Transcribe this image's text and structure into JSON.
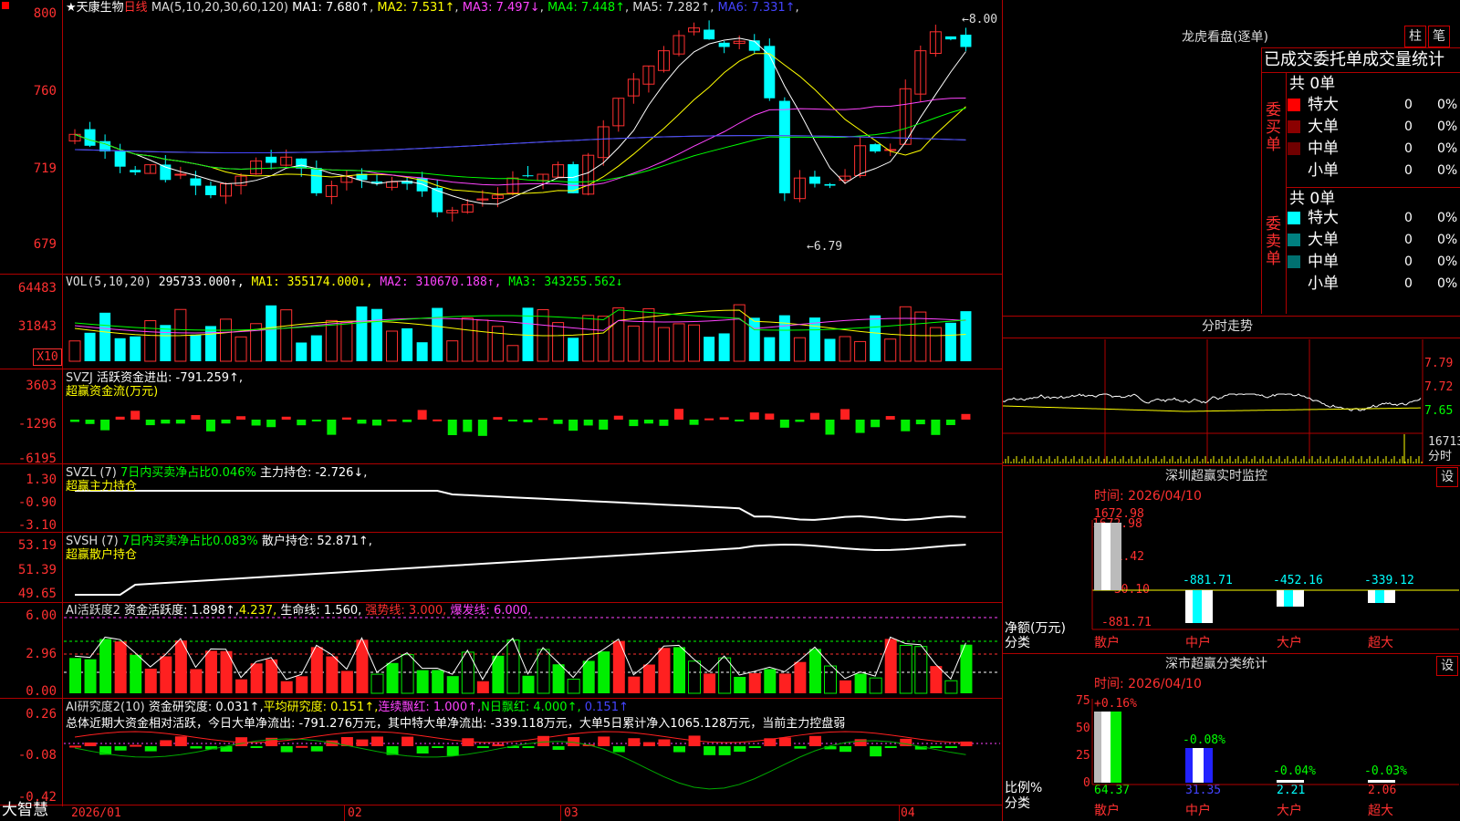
{
  "stock": {
    "name": "★天康生物",
    "period": "日线",
    "ma_label": "MA(5,10,20,30,60,120)",
    "ma_values": [
      {
        "label": "MA1:",
        "value": "7.680↑",
        "color": "#ffffff"
      },
      {
        "label": "MA2:",
        "value": "7.531↑",
        "color": "#ffff00"
      },
      {
        "label": "MA3:",
        "value": "7.497↓",
        "color": "#ff44ff"
      },
      {
        "label": "MA4:",
        "value": "7.448↑",
        "color": "#00ff00"
      },
      {
        "label": "MA5:",
        "value": "7.282↑",
        "color": "#dddddd"
      },
      {
        "label": "MA6:",
        "value": "7.331↑",
        "color": "#4444ff"
      }
    ],
    "high_mark": "8.00",
    "low_mark": "6.79",
    "y_ticks": [
      "800",
      "760",
      "719",
      "679"
    ]
  },
  "vol": {
    "title": "VOL(5,10,20)",
    "value": "295733.000↑,",
    "ma1": "MA1: 355174.000↓,",
    "ma2": "MA2: 310670.188↑,",
    "ma3": "MA3: 343255.562↓",
    "y_ticks": [
      "64483",
      "31843"
    ],
    "unit": "X10"
  },
  "svzj": {
    "title": "SVZJ",
    "label": "活跃资金进出: -791.259↑,",
    "subtitle": "超赢资金流(万元)",
    "y_ticks": [
      "3603",
      "-1296",
      "-6195"
    ]
  },
  "svzl": {
    "title": "SVZL (7)",
    "label1": "7日内买卖净占比0.046%",
    "label2": "主力持仓: -2.726↓,",
    "subtitle": "超赢主力持仓",
    "y_ticks": [
      "1.30",
      "-0.90",
      "-3.10"
    ]
  },
  "svsh": {
    "title": "SVSH (7)",
    "label1": "7日内买卖净占比0.083%",
    "label2": "散户持仓: 52.871↑,",
    "subtitle": "超赢散户持仓",
    "y_ticks": [
      "53.19",
      "51.39",
      "49.65"
    ]
  },
  "ai_active": {
    "title": "AI活跃度2",
    "label1": "资金活跃度: 1.898↑,",
    "label2": "4.237,",
    "label3": "生命线: 1.560,",
    "label4": "强势线: 3.000,",
    "label5": "爆发线: 6.000,",
    "y_ticks": [
      "6.00",
      "2.96",
      "0.00"
    ]
  },
  "ai_research": {
    "title": "AI研究度2(10)",
    "label1": "资金研究度: 0.031↑,",
    "label2": "平均研究度: 0.151↑,",
    "label3": "连续飘红: 1.000↑,",
    "label4": "N日飘红: 4.000↑,",
    "label5": "0.151↑",
    "summary": "总体近期大资金相对活跃，今日大单净流出: -791.276万元，其中特大单净流出: -339.118万元，大单5日累计净入1065.128万元，当前主力控盘弱",
    "y_ticks": [
      "0.26",
      "-0.08",
      "-0.42"
    ]
  },
  "x_axis": [
    "2026/01",
    "02",
    "03",
    "04"
  ],
  "footer_brand": "大智慧",
  "right": {
    "dragon_title": "龙虎看盘(逐单)",
    "tab_bar": "柱",
    "tab_line": "笔",
    "stat_title": "已成交委托单成交量统计",
    "buy_side": "委买单",
    "sell_side": "委卖单",
    "buy_total": "共 0单",
    "sell_total": "共 0单",
    "buy_rows": [
      {
        "label": "特大",
        "count": "0",
        "pct": "0%",
        "color": "#ff0000"
      },
      {
        "label": "大单",
        "count": "0",
        "pct": "0%",
        "color": "#8b0000"
      },
      {
        "label": "中单",
        "count": "0",
        "pct": "0%",
        "color": "#700000"
      },
      {
        "label": "小单",
        "count": "0",
        "pct": "0%",
        "color": ""
      }
    ],
    "sell_rows": [
      {
        "label": "特大",
        "count": "0",
        "pct": "0%",
        "color": "#00ffff"
      },
      {
        "label": "大单",
        "count": "0",
        "pct": "0%",
        "color": "#008080"
      },
      {
        "label": "中单",
        "count": "0",
        "pct": "0%",
        "color": "#007070"
      },
      {
        "label": "小单",
        "count": "0",
        "pct": "0%",
        "color": ""
      }
    ],
    "minute_title": "分时走势",
    "minute_ticks": [
      "7.79",
      "7.72",
      "7.65",
      "16713"
    ],
    "minute_label": "分时",
    "monitor_title": "深圳超赢实时监控",
    "monitor_time": "时间: 2026/04/10",
    "monitor_ticks": [
      "1672.98",
      "821.42",
      "-30.10",
      "-881.71"
    ],
    "monitor_values": [
      "1672.98",
      "-881.71",
      "-452.16",
      "-339.12"
    ],
    "monitor_ylabel1": "净额(万元)",
    "monitor_ylabel2": "分类",
    "categories": [
      "散户",
      "中户",
      "大户",
      "超大"
    ],
    "stat2_title": "深市超赢分类统计",
    "stat2_time": "时间: 2026/04/10",
    "stat2_ticks": [
      "75",
      "50",
      "25",
      "0"
    ],
    "stat2_deltas": [
      "+0.16%",
      "-0.08%",
      "-0.04%",
      "-0.03%"
    ],
    "stat2_values": [
      "64.37",
      "31.35",
      "2.21",
      "2.06"
    ],
    "stat2_ylabel1": "比例%",
    "stat2_ylabel2": "分类",
    "settings": "设"
  },
  "chart_data": {
    "type": "candlestick",
    "title": "天康生物 日线",
    "ylim": [
      6.79,
      8.0
    ],
    "x_ticks": [
      "2026/01",
      "02",
      "03",
      "04"
    ],
    "candles_close_approx": [
      7.36,
      7.3,
      7.27,
      7.19,
      7.16,
      7.2,
      7.12,
      7.15,
      7.09,
      7.04,
      7.1,
      7.14,
      7.22,
      7.21,
      7.24,
      7.18,
      7.05,
      7.09,
      7.14,
      7.12,
      7.1,
      7.11,
      7.1,
      7.06,
      6.95,
      6.96,
      6.99,
      7.02,
      7.04,
      7.13,
      7.14,
      7.15,
      7.2,
      7.05,
      7.25,
      7.4,
      7.55,
      7.65,
      7.72,
      7.8,
      7.88,
      7.92,
      7.86,
      7.82,
      7.85,
      7.8,
      7.55,
      7.05,
      7.13,
      7.1,
      7.09,
      7.14,
      7.3,
      7.27,
      7.28,
      7.6,
      7.8,
      7.9,
      7.86,
      7.82
    ],
    "volume_ma": {
      "ma1": 355174.0,
      "ma2": 310670.188,
      "ma3": 343255.562
    }
  }
}
